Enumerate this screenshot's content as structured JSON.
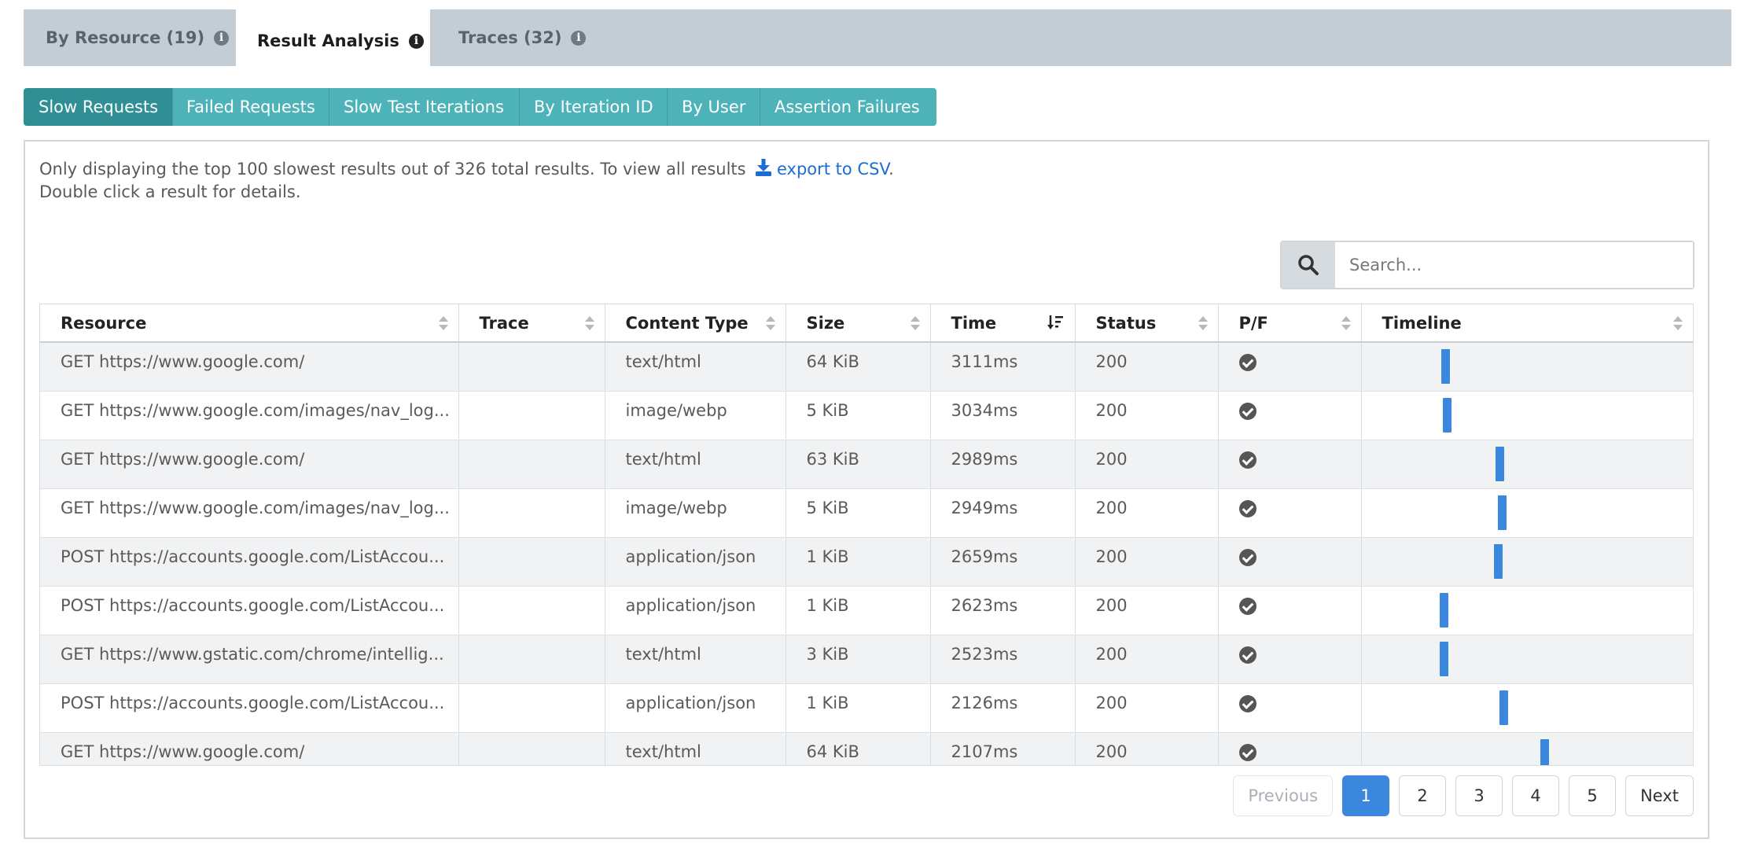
{
  "top_tabs": [
    {
      "label": "By Resource (19)",
      "active": false
    },
    {
      "label": "Result Analysis",
      "active": true
    },
    {
      "label": "Traces (32)",
      "active": false
    }
  ],
  "sub_tabs": [
    {
      "label": "Slow Requests",
      "active": true
    },
    {
      "label": "Failed Requests",
      "active": false
    },
    {
      "label": "Slow Test Iterations",
      "active": false
    },
    {
      "label": "By Iteration ID",
      "active": false
    },
    {
      "label": "By User",
      "active": false
    },
    {
      "label": "Assertion Failures",
      "active": false
    }
  ],
  "info": {
    "line1_prefix": "Only displaying the top 100 slowest results out of 326 total results. To view all results",
    "csv_link": "export to CSV",
    "line1_suffix": ".",
    "line2": "Double click a result for details."
  },
  "search": {
    "placeholder": "Search..."
  },
  "table": {
    "columns": [
      "Resource",
      "Trace",
      "Content Type",
      "Size",
      "Time",
      "Status",
      "P/F",
      "Timeline"
    ],
    "sorted_column": "Time",
    "rows": [
      {
        "resource": "GET https://www.google.com/",
        "trace": "",
        "content_type": "text/html",
        "size": "64 KiB",
        "time": "3111ms",
        "status": "200",
        "pf": "pass",
        "timeline_pos": 0.24
      },
      {
        "resource": "GET https://www.google.com/images/nav_log...",
        "trace": "",
        "content_type": "image/webp",
        "size": "5 KiB",
        "time": "3034ms",
        "status": "200",
        "pf": "pass",
        "timeline_pos": 0.245
      },
      {
        "resource": "GET https://www.google.com/",
        "trace": "",
        "content_type": "text/html",
        "size": "63 KiB",
        "time": "2989ms",
        "status": "200",
        "pf": "pass",
        "timeline_pos": 0.405
      },
      {
        "resource": "GET https://www.google.com/images/nav_log...",
        "trace": "",
        "content_type": "image/webp",
        "size": "5 KiB",
        "time": "2949ms",
        "status": "200",
        "pf": "pass",
        "timeline_pos": 0.41
      },
      {
        "resource": "POST https://accounts.google.com/ListAccou...",
        "trace": "",
        "content_type": "application/json",
        "size": "1 KiB",
        "time": "2659ms",
        "status": "200",
        "pf": "pass",
        "timeline_pos": 0.4
      },
      {
        "resource": "POST https://accounts.google.com/ListAccou...",
        "trace": "",
        "content_type": "application/json",
        "size": "1 KiB",
        "time": "2623ms",
        "status": "200",
        "pf": "pass",
        "timeline_pos": 0.235
      },
      {
        "resource": "GET https://www.gstatic.com/chrome/intellig...",
        "trace": "",
        "content_type": "text/html",
        "size": "3 KiB",
        "time": "2523ms",
        "status": "200",
        "pf": "pass",
        "timeline_pos": 0.235
      },
      {
        "resource": "POST https://accounts.google.com/ListAccou...",
        "trace": "",
        "content_type": "application/json",
        "size": "1 KiB",
        "time": "2126ms",
        "status": "200",
        "pf": "pass",
        "timeline_pos": 0.415
      },
      {
        "resource": "GET https://www.google.com/",
        "trace": "",
        "content_type": "text/html",
        "size": "64 KiB",
        "time": "2107ms",
        "status": "200",
        "pf": "pass",
        "timeline_pos": 0.54
      }
    ]
  },
  "pagination": {
    "previous": "Previous",
    "pages": [
      "1",
      "2",
      "3",
      "4",
      "5"
    ],
    "current": "1",
    "next": "Next"
  },
  "colors": {
    "accent": "#3b87dd",
    "subtab": "#4db3b8",
    "subtab_active": "#2f8f94",
    "tabbar": "#c4cdd4"
  }
}
